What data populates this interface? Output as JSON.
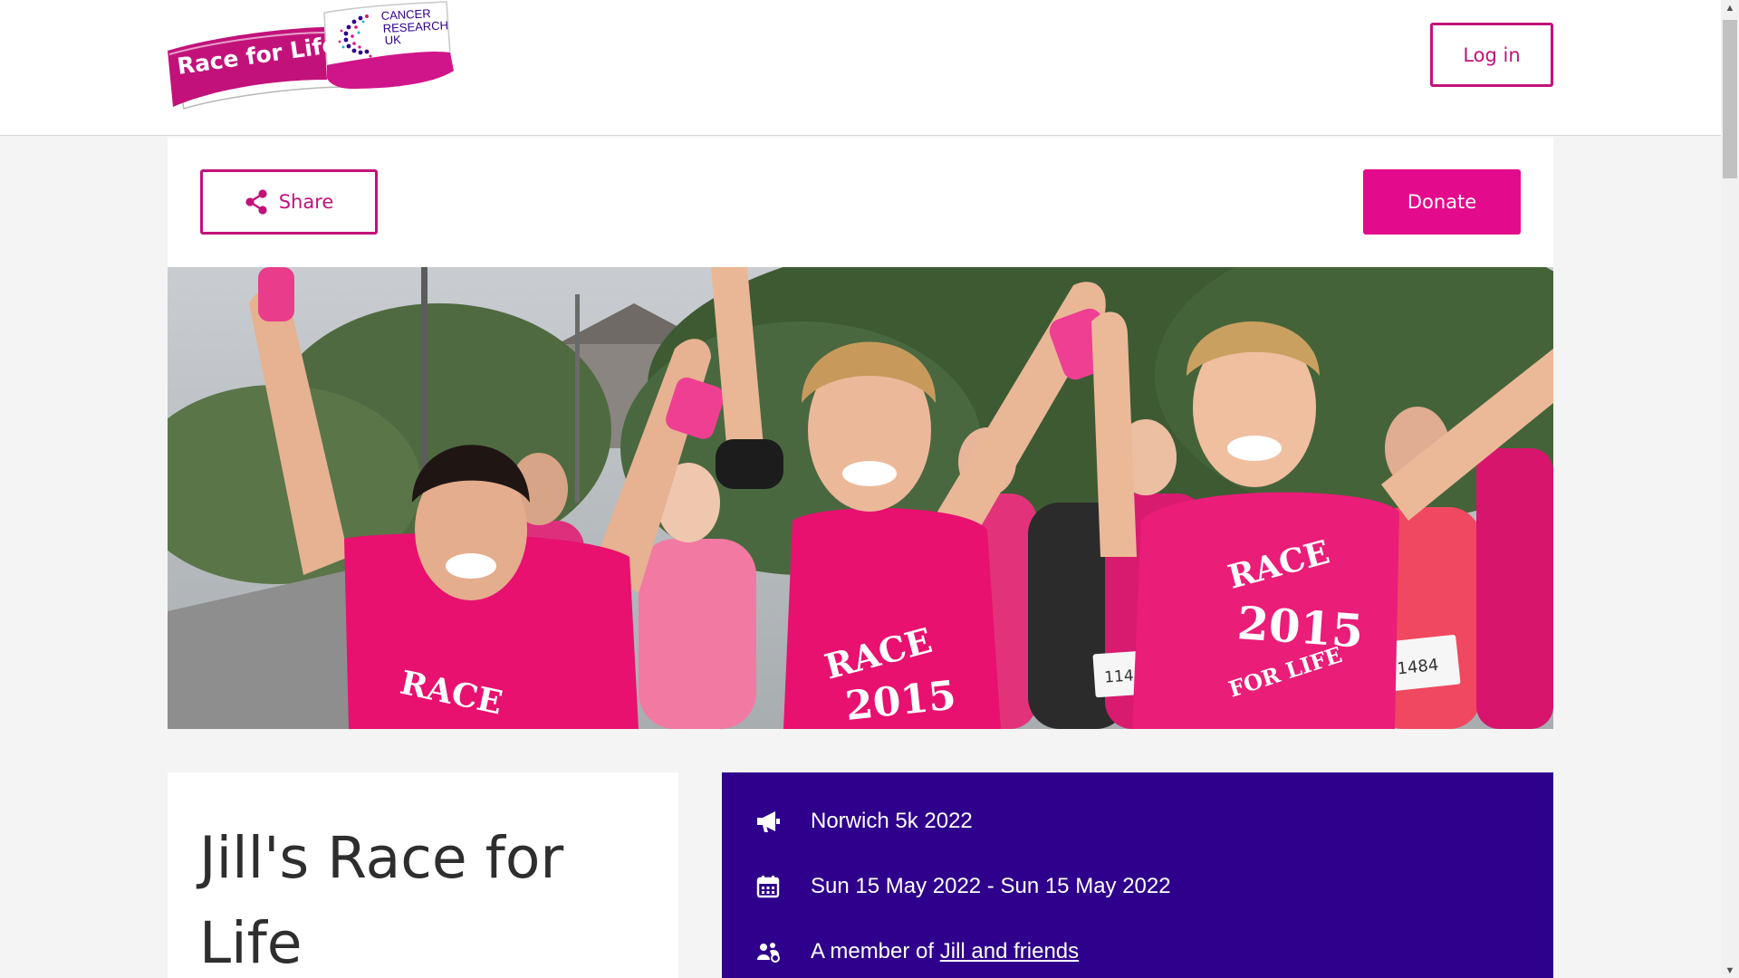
{
  "header": {
    "logo_text": "Race for Life",
    "logo_partner": [
      "CANCER",
      "RESEARCH",
      "UK"
    ],
    "login_label": "Log in"
  },
  "actions": {
    "share_label": "Share",
    "donate_label": "Donate"
  },
  "hero": {
    "shirt_texts": [
      "RACE",
      "2015",
      "FOR LIFE"
    ],
    "bib_numbers": [
      "1144",
      "1484"
    ]
  },
  "page": {
    "title": "Jill's Race for Life"
  },
  "details": {
    "event_name": "Norwich 5k 2022",
    "dates": "Sun 15 May 2022 - Sun 15 May 2022",
    "member_prefix": "A member of",
    "team_link": "Jill and friends"
  },
  "colors": {
    "brand_pink": "#e40a8c",
    "outline_pink": "#c2127a",
    "panel_purple": "#2e008b"
  },
  "icons": {
    "share": "share-icon",
    "event": "megaphone-icon",
    "dates": "calendar-icon",
    "team": "team-icon"
  }
}
